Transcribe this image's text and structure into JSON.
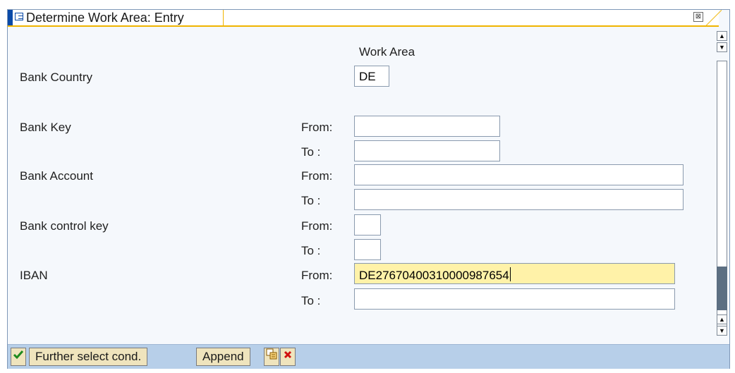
{
  "window": {
    "title": "Determine Work Area: Entry",
    "close_glyph": "⊠"
  },
  "header": {
    "work_area": "Work Area"
  },
  "fields": {
    "bank_country": {
      "label": "Bank Country",
      "value": "DE"
    },
    "bank_key": {
      "label": "Bank Key",
      "from_label": "From:",
      "to_label": "To :",
      "from_value": "",
      "to_value": ""
    },
    "bank_account": {
      "label": "Bank Account",
      "from_label": "From:",
      "to_label": "To :",
      "from_value": "",
      "to_value": ""
    },
    "bank_control_key": {
      "label": "Bank control key",
      "from_label": "From:",
      "to_label": "To :",
      "from_value": "",
      "to_value": ""
    },
    "iban": {
      "label": "IBAN",
      "from_label": "From:",
      "to_label": "To :",
      "from_value": "DE27670400310000987654",
      "to_value": ""
    }
  },
  "toolbar": {
    "confirm_icon": "check-icon",
    "further_select_label": "Further select cond.",
    "append_label": "Append",
    "multi_select_icon": "multiple-selection-icon",
    "cancel_icon": "cancel-icon"
  },
  "colors": {
    "active_field": "#fff2a8",
    "toolbar_bg": "#b7cfe9",
    "title_accent": "#f0b400",
    "brand_blue": "#0a4aa8"
  }
}
